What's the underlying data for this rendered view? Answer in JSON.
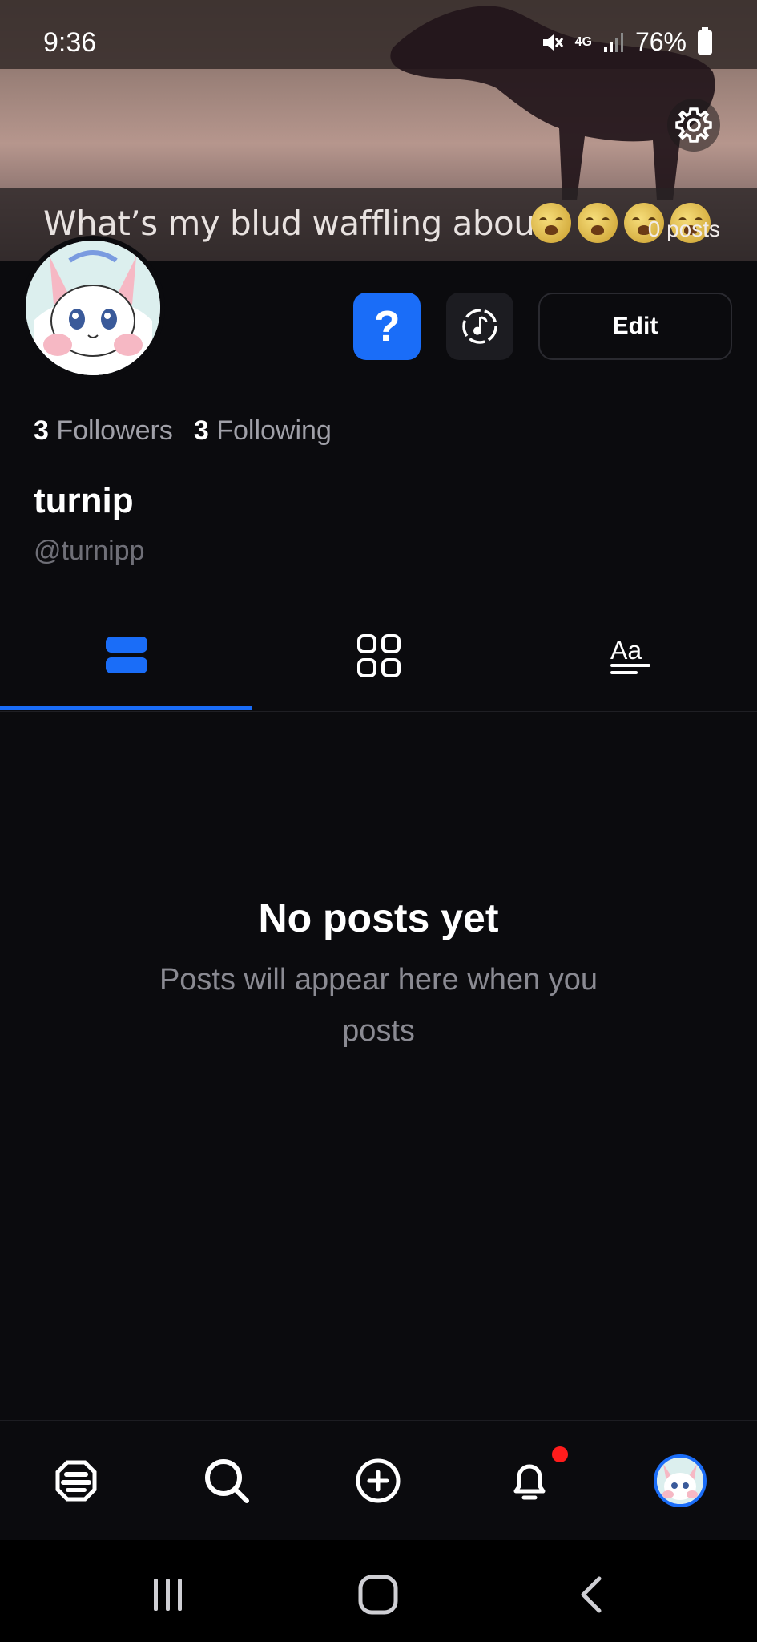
{
  "status_bar": {
    "time": "9:36",
    "network": "4G",
    "battery": "76%"
  },
  "banner": {
    "caption": "What’s my blud waffling about",
    "posts_count": "0 posts"
  },
  "profile": {
    "edit_label": "Edit",
    "help_label": "?",
    "followers_count": "3",
    "followers_label": "Followers",
    "following_count": "3",
    "following_label": "Following",
    "display_name": "turnip",
    "handle": "@turnipp"
  },
  "tabs": [
    {
      "icon": "list-view-icon",
      "active": true
    },
    {
      "icon": "grid-view-icon",
      "active": false
    },
    {
      "icon": "text-posts-icon",
      "active": false
    }
  ],
  "empty_state": {
    "title": "No posts yet",
    "subtitle": "Posts will appear here when you posts"
  },
  "bottom_nav": [
    {
      "icon": "home-hive-icon"
    },
    {
      "icon": "search-icon"
    },
    {
      "icon": "create-post-icon"
    },
    {
      "icon": "notifications-bell-icon",
      "badge": true
    },
    {
      "icon": "profile-avatar"
    }
  ],
  "colors": {
    "accent": "#1a6df8",
    "background": "#0b0b0e",
    "notification": "#ff1c1c"
  }
}
